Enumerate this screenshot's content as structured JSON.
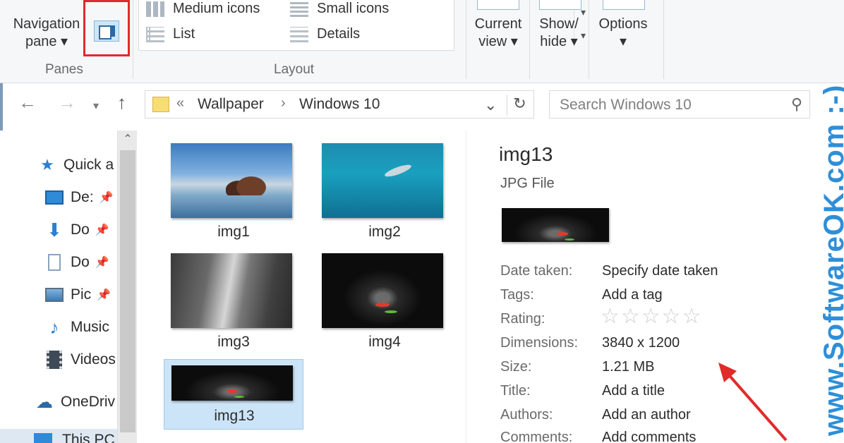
{
  "ribbon": {
    "navigation_pane_label_1": "Navigation",
    "navigation_pane_label_2": "pane ▾",
    "panes_group": "Panes",
    "layout_group": "Layout",
    "layout_items": {
      "medium": "Medium icons",
      "small": "Small icons",
      "list": "List",
      "details": "Details"
    },
    "current_view_1": "Current",
    "current_view_2": "view ▾",
    "show_hide_1": "Show/",
    "show_hide_2": "hide ▾",
    "options_1": "Options",
    "options_2": "▾"
  },
  "address": {
    "prefix": "«",
    "crumb_1": "Wallpaper",
    "sep": "›",
    "crumb_2": "Windows 10"
  },
  "search": {
    "placeholder": "Search Windows 10"
  },
  "nav": {
    "quick_access": "Quick a",
    "desktop": "De:",
    "downloads": "Do",
    "documents": "Do",
    "pictures": "Pic",
    "music": "Music",
    "videos": "Videos",
    "onedrive": "OneDriv",
    "this_pc": "This PC"
  },
  "files": [
    {
      "name": "img1"
    },
    {
      "name": "img2"
    },
    {
      "name": "img3"
    },
    {
      "name": "img4"
    },
    {
      "name": "img13"
    }
  ],
  "details": {
    "title": "img13",
    "type": "JPG File",
    "rating_stars": "☆☆☆☆☆",
    "labels": {
      "date_taken": "Date taken:",
      "tags": "Tags:",
      "rating": "Rating:",
      "dimensions": "Dimensions:",
      "size": "Size:",
      "title": "Title:",
      "authors": "Authors:",
      "comments": "Comments:"
    },
    "values": {
      "date_taken": "Specify date taken",
      "tags": "Add a tag",
      "dimensions": "3840 x 1200",
      "size": "1.21 MB",
      "title": "Add a title",
      "authors": "Add an author",
      "comments": "Add comments"
    }
  },
  "watermark": "www.SoftwareOK.com :-)",
  "colors": {
    "highlight_box": "#e02b2b",
    "arrow": "#e02b2b",
    "watermark": "#2e8fd8",
    "selection": "#cce4f7"
  }
}
